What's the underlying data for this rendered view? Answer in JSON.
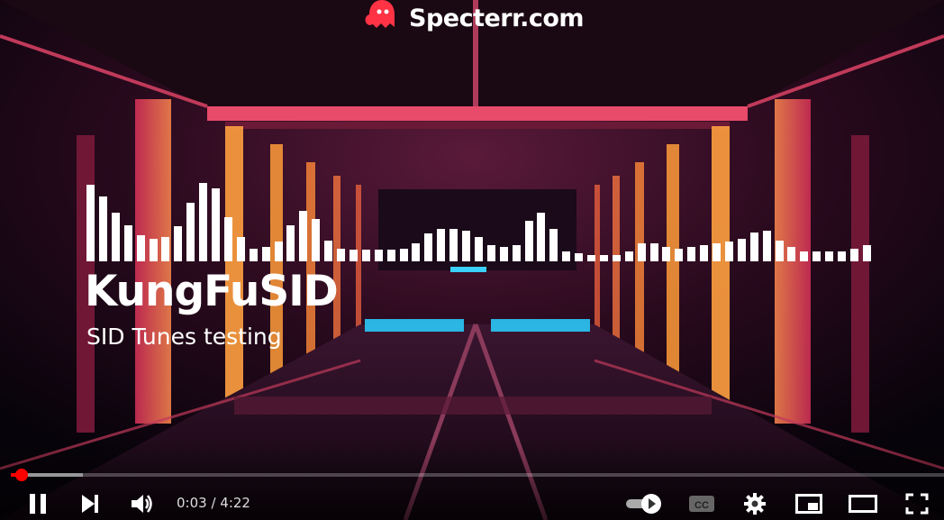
{
  "brand": {
    "name": "Specterr.com",
    "logo": "ghost-logo-icon"
  },
  "track": {
    "title": "KungFuSID",
    "subtitle": "SID Tunes testing"
  },
  "visualizer": {
    "levels": [
      0.95,
      0.8,
      0.6,
      0.44,
      0.32,
      0.28,
      0.3,
      0.43,
      0.72,
      0.97,
      0.9,
      0.55,
      0.3,
      0.16,
      0.18,
      0.24,
      0.44,
      0.62,
      0.52,
      0.26,
      0.16,
      0.14,
      0.14,
      0.14,
      0.14,
      0.16,
      0.22,
      0.34,
      0.4,
      0.4,
      0.38,
      0.3,
      0.2,
      0.18,
      0.2,
      0.5,
      0.6,
      0.4,
      0.12,
      0.1,
      0.08,
      0.08,
      0.08,
      0.12,
      0.22,
      0.22,
      0.18,
      0.16,
      0.18,
      0.2,
      0.22,
      0.24,
      0.28,
      0.36,
      0.38,
      0.26,
      0.18,
      0.12,
      0.12,
      0.12,
      0.12,
      0.16,
      0.2
    ],
    "color": "#ffffff"
  },
  "player": {
    "time_current": "0:03",
    "time_separator": " / ",
    "time_total": "4:22",
    "progress_played_fraction": 0.012,
    "progress_loaded_fraction": 0.077,
    "accent_color": "#ff0000",
    "icons": {
      "pause": "pause-icon",
      "next": "next-icon",
      "volume": "volume-icon",
      "autoplay": "autoplay-toggle-icon",
      "captions": "captions-icon",
      "settings": "gear-icon",
      "miniplayer": "miniplayer-icon",
      "theater": "theater-mode-icon",
      "fullscreen": "fullscreen-icon"
    }
  }
}
